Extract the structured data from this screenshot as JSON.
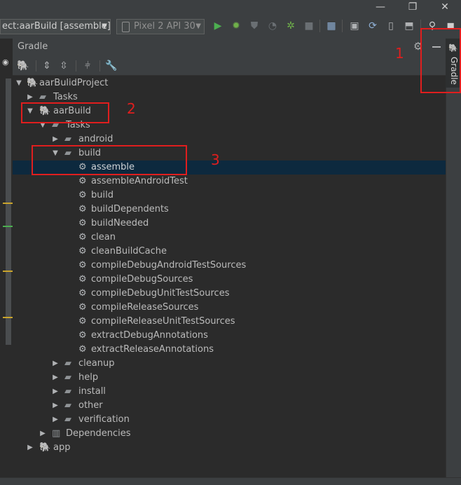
{
  "toolbar": {
    "run_config": "ect:aarBuild [assemble]",
    "device": "Pixel 2 API 30"
  },
  "panel": {
    "title": "Gradle",
    "side_tab_label": "Gradle"
  },
  "tree": {
    "root": "aarBulidProject",
    "root_tasks": "Tasks",
    "module": "aarBuild",
    "module_tasks": "Tasks",
    "android_group": "android",
    "build_group": "build",
    "build_tasks": [
      "assemble",
      "assembleAndroidTest",
      "build",
      "buildDependents",
      "buildNeeded",
      "clean",
      "cleanBuildCache",
      "compileDebugAndroidTestSources",
      "compileDebugSources",
      "compileDebugUnitTestSources",
      "compileReleaseSources",
      "compileReleaseUnitTestSources",
      "extractDebugAnnotations",
      "extractReleaseAnnotations"
    ],
    "other_groups": [
      "cleanup",
      "help",
      "install",
      "other",
      "verification"
    ],
    "dependencies": "Dependencies",
    "app": "app"
  },
  "annotations": {
    "label_1": "1",
    "label_2": "2",
    "label_3": "3"
  },
  "colors": {
    "selection": "#0d293e",
    "annotation_red": "#e01e1e",
    "run_green": "#4caf50"
  }
}
